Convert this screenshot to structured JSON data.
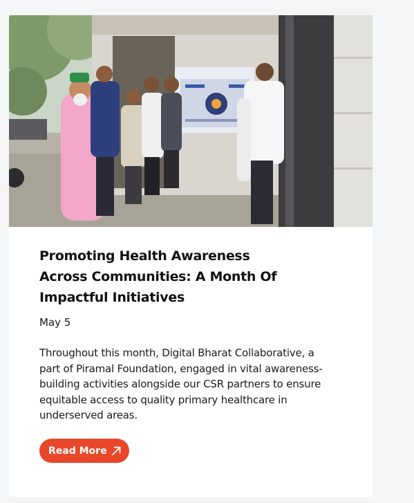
{
  "post": {
    "image_alt": "People viewing a health awareness poster outside a clinic",
    "title": "Promoting Health Awareness Across Communities: A Month Of Impactful Initiatives",
    "date": "May 5",
    "excerpt": "Throughout this month, Digital Bharat Collaborative, a part of Piramal Foundation, engaged in vital awareness-building activities alongside our CSR partners to ensure equitable access to quality primary healthcare in underserved areas.",
    "cta_label": "Read More",
    "cta_icon": "arrow-up-right-icon"
  },
  "colors": {
    "page_bg": "#f4f5f7",
    "card_bg": "#ffffff",
    "accent": "#e8472a",
    "text": "#111111"
  }
}
